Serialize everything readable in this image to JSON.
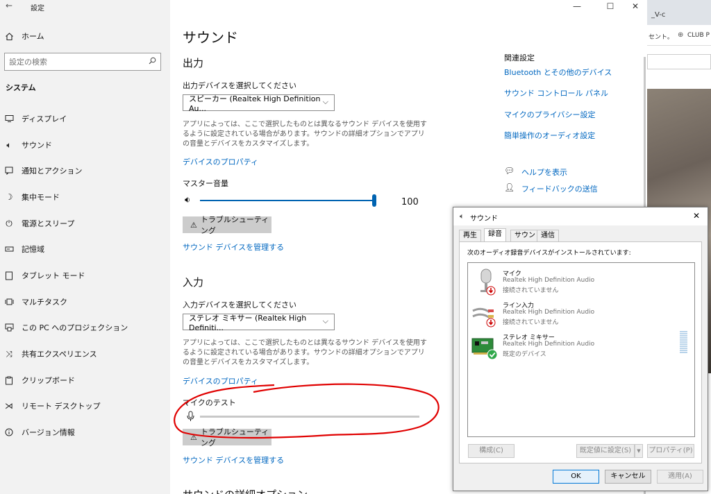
{
  "settings_window": {
    "title": "設定",
    "controls": {
      "minimize": "—",
      "maximize": "☐",
      "close": "✕"
    }
  },
  "sidebar": {
    "home": "ホーム",
    "search_placeholder": "設定の検索",
    "section": "システム",
    "items": [
      {
        "label": "ディスプレイ",
        "icon": "display-icon"
      },
      {
        "label": "サウンド",
        "icon": "speaker-icon"
      },
      {
        "label": "通知とアクション",
        "icon": "notification-icon"
      },
      {
        "label": "集中モード",
        "icon": "moon-icon"
      },
      {
        "label": "電源とスリープ",
        "icon": "power-icon"
      },
      {
        "label": "記憶域",
        "icon": "storage-icon"
      },
      {
        "label": "タブレット モード",
        "icon": "tablet-icon"
      },
      {
        "label": "マルチタスク",
        "icon": "multitask-icon"
      },
      {
        "label": "この PC へのプロジェクション",
        "icon": "projection-icon"
      },
      {
        "label": "共有エクスペリエンス",
        "icon": "share-icon"
      },
      {
        "label": "クリップボード",
        "icon": "clipboard-icon"
      },
      {
        "label": "リモート デスクトップ",
        "icon": "remote-icon"
      },
      {
        "label": "バージョン情報",
        "icon": "info-icon"
      }
    ]
  },
  "main": {
    "page_title": "サウンド",
    "output": {
      "heading": "出力",
      "select_label": "出力デバイスを選択してください",
      "selected_device": "スピーカー (Realtek High Definition Au...",
      "description": "アプリによっては、ここで選択したものとは異なるサウンド デバイスを使用するように設定されている場合があります。サウンドの詳細オプションでアプリの音量とデバイスをカスタマイズします。",
      "properties_link": "デバイスのプロパティ",
      "volume_label": "マスター音量",
      "volume_value": "100",
      "troubleshoot": "トラブルシューティング",
      "manage_link": "サウンド デバイスを管理する"
    },
    "input": {
      "heading": "入力",
      "select_label": "入力デバイスを選択してください",
      "selected_device": "ステレオ ミキサー (Realtek High Definiti...",
      "description": "アプリによっては、ここで選択したものとは異なるサウンド デバイスを使用するように設定されている場合があります。サウンドの詳細オプションでアプリの音量とデバイスをカスタマイズします。",
      "properties_link": "デバイスのプロパティ",
      "mic_test_label": "マイクのテスト",
      "troubleshoot": "トラブルシューティング",
      "manage_link": "サウンド デバイスを管理する"
    },
    "advanced_heading": "サウンドの詳細オプション",
    "related": {
      "heading": "関連設定",
      "links": [
        "Bluetooth とその他のデバイス",
        "サウンド コントロール パネル",
        "マイクのプライバシー設定",
        "簡単操作のオーディオ設定"
      ],
      "help": "ヘルプを表示",
      "feedback": "フィードバックの送信"
    }
  },
  "background": {
    "tab_fragment": "_V-c",
    "bookmark_fragment": "セント。",
    "bookmark2": "CLUB P"
  },
  "sound_dialog": {
    "title": "サウンド",
    "close": "✕",
    "tabs": [
      "再生",
      "録音",
      "サウンド",
      "通信"
    ],
    "active_tab": "録音",
    "prompt": "次のオーディオ録音デバイスがインストールされています:",
    "devices": [
      {
        "name": "マイク",
        "driver": "Realtek High Definition Audio",
        "status": "接続されていません"
      },
      {
        "name": "ライン入力",
        "driver": "Realtek High Definition Audio",
        "status": "接続されていません"
      },
      {
        "name": "ステレオ ミキサー",
        "driver": "Realtek High Definition Audio",
        "status": "既定のデバイス"
      }
    ],
    "buttons": {
      "configure": "構成(C)",
      "set_default": "既定値に設定(S)",
      "properties": "プロパティ(P)",
      "ok": "OK",
      "cancel": "キャンセル",
      "apply": "適用(A)"
    }
  },
  "colors": {
    "link": "#0067c0",
    "annotation": "#e00000",
    "slider_fill": "#0063b1"
  }
}
